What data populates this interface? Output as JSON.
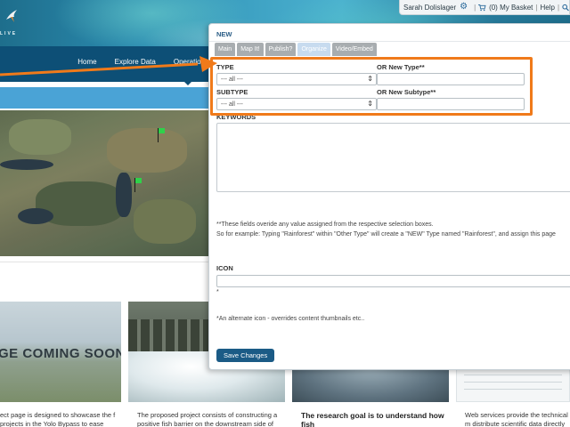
{
  "site": {
    "logo_text": "LIVE",
    "user_bar": {
      "user": "Sarah Dolislager",
      "basket": "(0) My Basket",
      "help": "Help"
    },
    "nav": [
      "Home",
      "Explore Data",
      "Operations"
    ],
    "cards": [
      {
        "image_text": "GE COMING SOON",
        "text": "ect page is designed to showcase the f projects in the Yolo Bypass to ease"
      },
      {
        "text": "The proposed project consists of constructing a positive fish barrier on the downstream side of"
      },
      {
        "text": "The research goal is to understand how fish"
      },
      {
        "text": "Web services provide the technical m distribute scientific data directly fro"
      }
    ]
  },
  "modal": {
    "title": "NEW",
    "tabs": [
      "Main",
      "Map It!",
      "Publish?",
      "Organize",
      "Video/Embed"
    ],
    "active_tab": "Organize",
    "type_label": "TYPE",
    "type_value": "--- all ---",
    "new_type_label": "OR New Type**",
    "subtype_label": "SUBTYPE",
    "subtype_value": "--- all ---",
    "new_subtype_label": "OR New Subtype**",
    "keywords_label": "KEYWORDS",
    "help_line1": "**These fields overide any value assigned from the respective selection boxes.",
    "help_line2": "So for example: Typing \"Rainforest\" within \"Other Type\" will create a \"NEW\" Type named \"Rainforest\", and assign this page",
    "icon_label": "ICON",
    "icon_asterisk": "*",
    "icon_help": "*An alternate icon - overrides content thumbnails etc..",
    "save_label": "Save Changes"
  },
  "colors": {
    "accent": "#f07a1a",
    "nav": "#0d4f76",
    "button": "#1b5b86",
    "marker": "#2fd14a"
  }
}
